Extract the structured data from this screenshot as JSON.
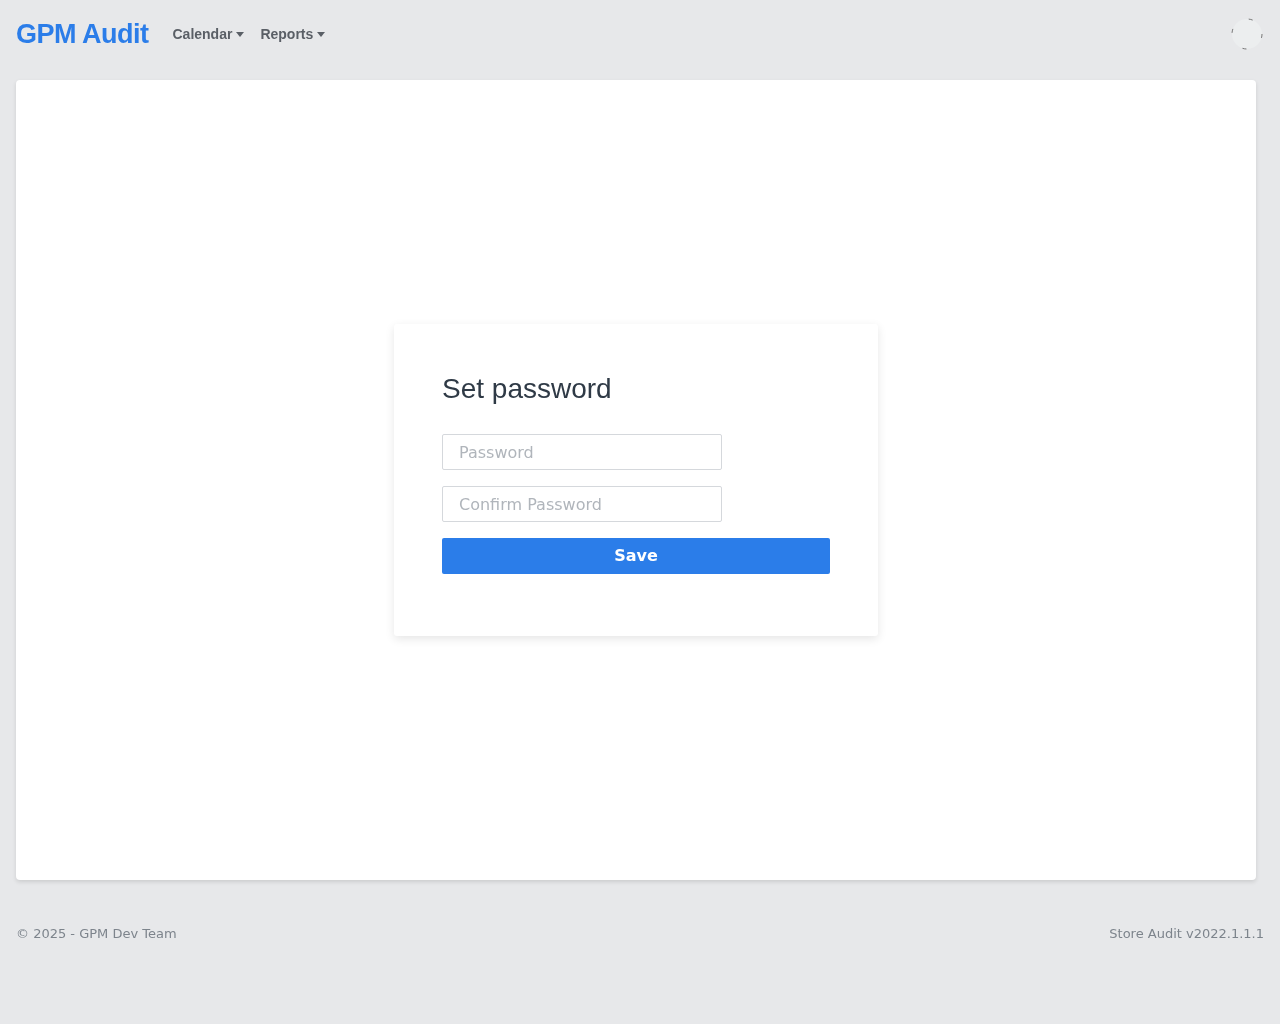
{
  "navbar": {
    "brand": "GPM Audit",
    "menus": [
      {
        "label": "Calendar"
      },
      {
        "label": "Reports"
      }
    ]
  },
  "form": {
    "title": "Set password",
    "fields": [
      {
        "placeholder": "Password"
      },
      {
        "placeholder": "Confirm Password"
      }
    ],
    "button": "Save"
  },
  "footer": {
    "left": "© 2025 - GPM Dev Team",
    "right": "Store Audit v2022.1.1.1"
  }
}
